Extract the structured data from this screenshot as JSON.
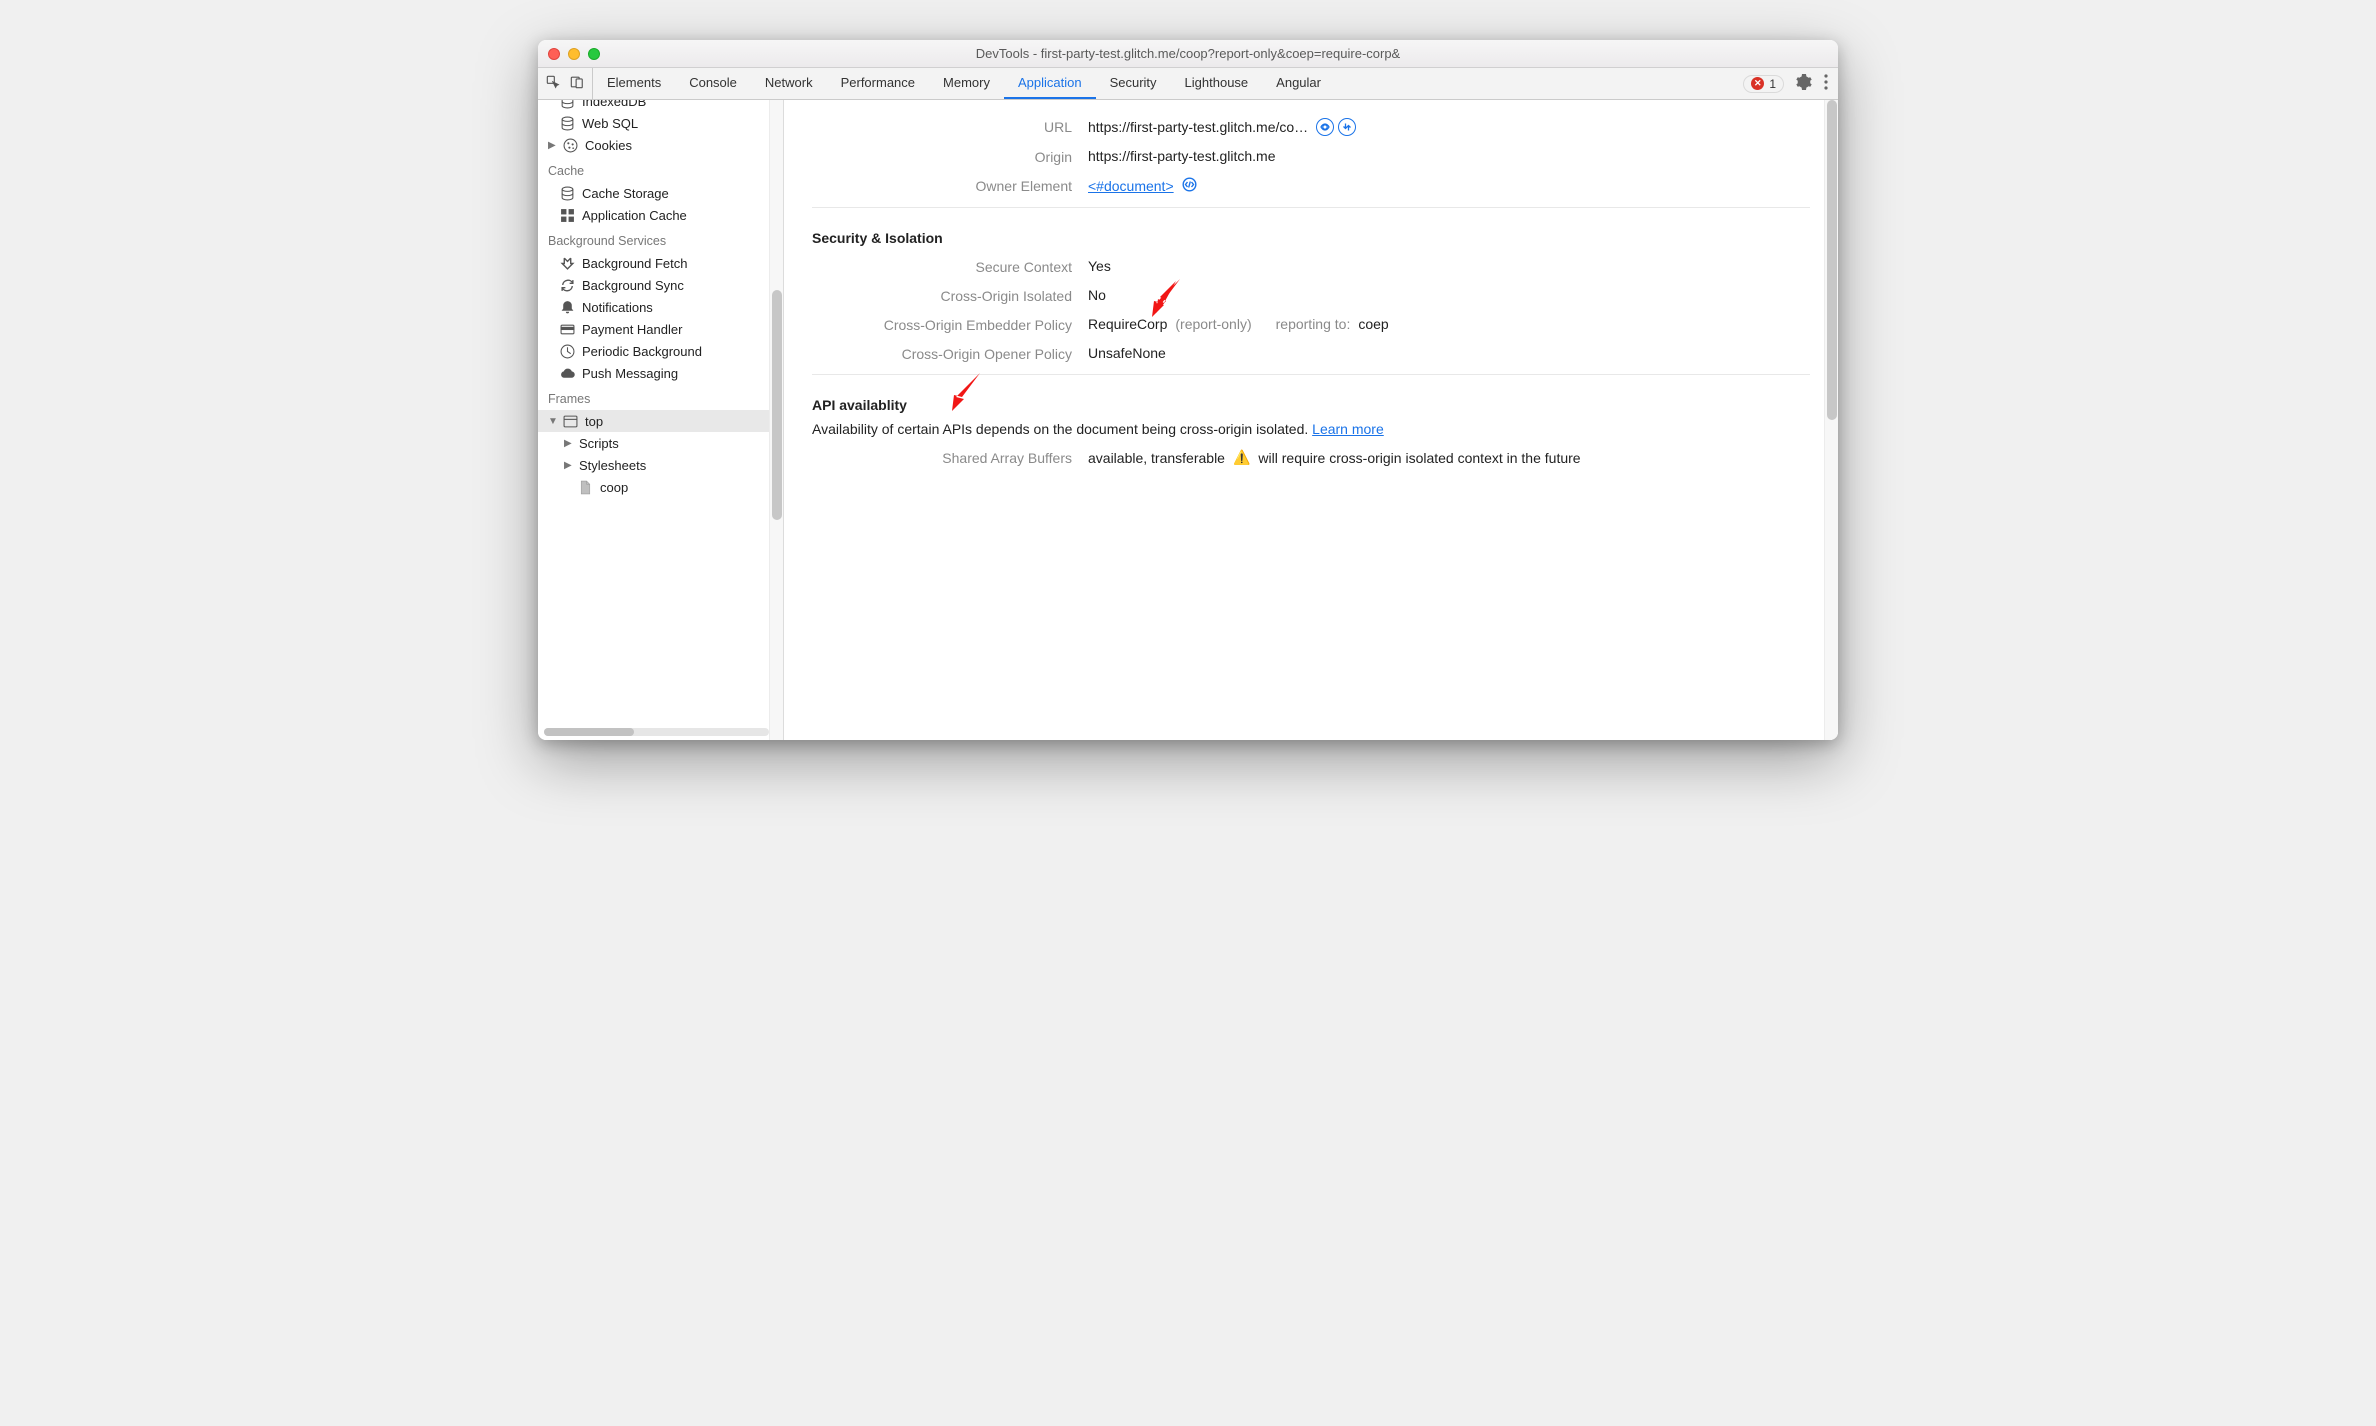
{
  "window": {
    "title": "DevTools - first-party-test.glitch.me/coop?report-only&coep=require-corp&"
  },
  "toolbar": {
    "tabs": [
      {
        "label": "Elements"
      },
      {
        "label": "Console"
      },
      {
        "label": "Network"
      },
      {
        "label": "Performance"
      },
      {
        "label": "Memory"
      },
      {
        "label": "Application",
        "active": true
      },
      {
        "label": "Security"
      },
      {
        "label": "Lighthouse"
      },
      {
        "label": "Angular"
      }
    ],
    "error_count": "1"
  },
  "sidebar": {
    "storage_items": [
      {
        "label": "IndexedDB",
        "icon": "database"
      },
      {
        "label": "Web SQL",
        "icon": "database"
      },
      {
        "label": "Cookies",
        "icon": "cookie",
        "expandable": true
      }
    ],
    "cache": {
      "title": "Cache",
      "items": [
        {
          "label": "Cache Storage",
          "icon": "database"
        },
        {
          "label": "Application Cache",
          "icon": "grid"
        }
      ]
    },
    "bg": {
      "title": "Background Services",
      "items": [
        {
          "label": "Background Fetch",
          "icon": "fetch"
        },
        {
          "label": "Background Sync",
          "icon": "sync"
        },
        {
          "label": "Notifications",
          "icon": "bell"
        },
        {
          "label": "Payment Handler",
          "icon": "card"
        },
        {
          "label": "Periodic Background",
          "icon": "clock"
        },
        {
          "label": "Push Messaging",
          "icon": "cloud"
        }
      ]
    },
    "frames": {
      "title": "Frames",
      "top": {
        "label": "top",
        "selected": true
      },
      "children": [
        {
          "label": "Scripts",
          "expandable": true
        },
        {
          "label": "Stylesheets",
          "expandable": true
        },
        {
          "label": "coop",
          "icon": "document"
        }
      ]
    }
  },
  "main": {
    "document": {
      "url_label": "URL",
      "url_value": "https://first-party-test.glitch.me/co…",
      "origin_label": "Origin",
      "origin_value": "https://first-party-test.glitch.me",
      "owner_label": "Owner Element",
      "owner_value": "<#document>"
    },
    "sec": {
      "title": "Security & Isolation",
      "rows": {
        "secure_ctx": {
          "k": "Secure Context",
          "v": "Yes"
        },
        "coi": {
          "k": "Cross-Origin Isolated",
          "v": "No"
        },
        "coep": {
          "k": "Cross-Origin Embedder Policy",
          "v": "RequireCorp",
          "qual": "(report-only)",
          "report_k": "reporting to:",
          "report_v": "coep"
        },
        "coop": {
          "k": "Cross-Origin Opener Policy",
          "v": "UnsafeNone"
        }
      }
    },
    "api": {
      "title": "API availablity",
      "desc": "Availability of certain APIs depends on the document being cross-origin isolated. ",
      "learn_more": "Learn more",
      "sab": {
        "k": "Shared Array Buffers",
        "v": "available, transferable",
        "warn": "will require cross-origin isolated context in the future"
      }
    }
  }
}
